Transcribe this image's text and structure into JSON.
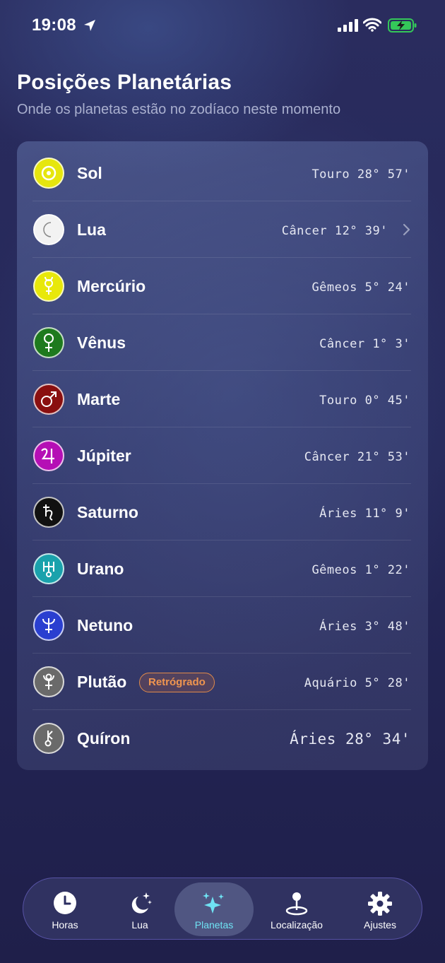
{
  "status_bar": {
    "time": "19:08"
  },
  "header": {
    "title": "Posições Planetárias",
    "subtitle": "Onde os planetas estão no zodíaco neste momento"
  },
  "planets": [
    {
      "name": "Sol",
      "position": "Touro 28° 57'",
      "icon": "sun-icon",
      "color": "#e6e60e"
    },
    {
      "name": "Lua",
      "position": "Câncer 12° 39'",
      "icon": "moon-icon",
      "color": "#f2f2f2"
    },
    {
      "name": "Mercúrio",
      "position": "Gêmeos 5° 24'",
      "icon": "mercury-icon",
      "color": "#e8e80a"
    },
    {
      "name": "Vênus",
      "position": "Câncer 1° 3'",
      "icon": "venus-icon",
      "color": "#1e7a1e"
    },
    {
      "name": "Marte",
      "position": "Touro 0° 45'",
      "icon": "mars-icon",
      "color": "#8a0f0f"
    },
    {
      "name": "Júpiter",
      "position": "Câncer 21° 53'",
      "icon": "jupiter-icon",
      "color": "#b50fb5"
    },
    {
      "name": "Saturno",
      "position": "Áries 11° 9'",
      "icon": "saturn-icon",
      "color": "#111111"
    },
    {
      "name": "Urano",
      "position": "Gêmeos 1° 22'",
      "icon": "uranus-icon",
      "color": "#1aa2ac"
    },
    {
      "name": "Netuno",
      "position": "Áries 3° 48'",
      "icon": "neptune-icon",
      "color": "#2a3fd0"
    },
    {
      "name": "Plutão",
      "position": "Aquário 5° 28'",
      "icon": "pluto-icon",
      "color": "#6a6a6a",
      "badge": "Retrógrado"
    },
    {
      "name": "Quíron",
      "position": "Áries 28° 34'",
      "icon": "chiron-icon",
      "color": "#6a6a6a"
    }
  ],
  "colors": {
    "accent": "#6fe3f4",
    "retrograde": "#f0954f"
  },
  "tabbar": {
    "tabs": [
      {
        "label": "Horas",
        "icon": "clock-icon"
      },
      {
        "label": "Lua",
        "icon": "moon-stars-icon"
      },
      {
        "label": "Planetas",
        "icon": "sparkles-icon",
        "active": true
      },
      {
        "label": "Localização",
        "icon": "map-pin-icon"
      },
      {
        "label": "Ajustes",
        "icon": "gear-icon"
      }
    ]
  }
}
